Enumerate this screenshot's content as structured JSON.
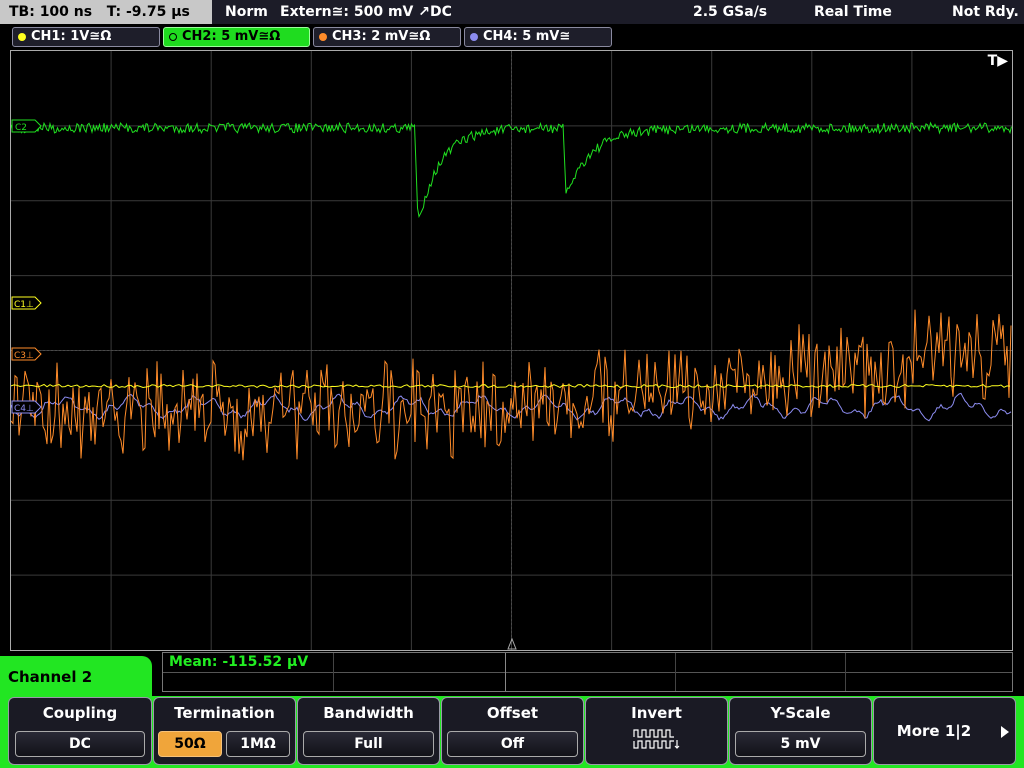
{
  "status": {
    "timebase": "TB: 100 ns",
    "trigger_time": "T: -9.75 µs",
    "mode": "Norm",
    "trigger_source": "Extern≅: 500 mV ↗DC",
    "sample_rate": "2.5 GSa/s",
    "acquisition": "Real Time",
    "state": "Not Rdy."
  },
  "channels": [
    {
      "label": "CH1: 1V≅Ω",
      "color": "#ffff20"
    },
    {
      "label": "CH2: 5 mV≅Ω",
      "color": "#20e020"
    },
    {
      "label": "CH3: 2 mV≅Ω",
      "color": "#ff8c2a"
    },
    {
      "label": "CH4: 5 mV≅",
      "color": "#8c8cf0"
    }
  ],
  "screen": {
    "trigger_marker": "T▶",
    "level_markers": {
      "c1": "C1⊥",
      "c3": "C3⊥",
      "c4": "C4⊥",
      "c2": "C2"
    }
  },
  "measurement": {
    "text": "Mean: -115.52 µV"
  },
  "menu": {
    "title": "Channel 2",
    "coupling": {
      "title": "Coupling",
      "value": "DC"
    },
    "termination": {
      "title": "Termination",
      "opt1": "50Ω",
      "opt2": "1MΩ"
    },
    "bandwidth": {
      "title": "Bandwidth",
      "value": "Full"
    },
    "offset": {
      "title": "Offset",
      "value": "Off"
    },
    "invert": {
      "title": "Invert"
    },
    "yscale": {
      "title": "Y-Scale",
      "value": "5 mV"
    },
    "more": {
      "label": "More 1|2"
    }
  }
}
